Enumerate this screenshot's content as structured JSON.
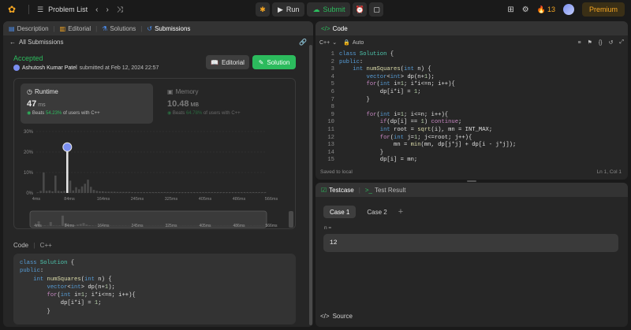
{
  "topbar": {
    "problem_list": "Problem List",
    "run": "Run",
    "submit": "Submit",
    "streak": "13",
    "premium": "Premium"
  },
  "left_tabs": [
    {
      "label": "Description",
      "icon": "description-icon"
    },
    {
      "label": "Editorial",
      "icon": "editorial-icon"
    },
    {
      "label": "Solutions",
      "icon": "solutions-icon"
    },
    {
      "label": "Submissions",
      "icon": "submissions-icon"
    }
  ],
  "submission": {
    "back_label": "All Submissions",
    "status": "Accepted",
    "author": "Ashutosh Kumar Patel",
    "submitted_text": "submitted at Feb 12, 2024 22:57",
    "editorial_btn": "Editorial",
    "solution_btn": "Solution"
  },
  "runtime": {
    "title": "Runtime",
    "value": "47",
    "unit": "ms",
    "beats_prefix": "Beats",
    "beats_pct": "54.23%",
    "beats_suffix": "of users with C++"
  },
  "memory": {
    "title": "Memory",
    "value": "10.48",
    "unit": "MB",
    "beats_prefix": "Beats",
    "beats_pct": "64.78%",
    "beats_suffix": "of users with C++"
  },
  "chart_data": {
    "type": "bar",
    "title": "",
    "xlabel": "",
    "ylabel": "",
    "y_ticks": [
      "30%",
      "20%",
      "10%",
      "0%"
    ],
    "ylim": [
      0,
      30
    ],
    "x_ticks": [
      "4ms",
      "84ms",
      "164ms",
      "245ms",
      "325ms",
      "405ms",
      "486ms",
      "566ms"
    ],
    "range_ticks": [
      "4ms",
      "84ms",
      "164ms",
      "245ms",
      "325ms",
      "405ms",
      "486ms",
      "566ms"
    ],
    "highlight_value_ms": 47,
    "values": [
      0.3,
      1.0,
      10.0,
      1.0,
      1.2,
      0.8,
      8.5,
      1.0,
      0.8,
      1.0,
      22.0,
      6.0,
      1.2,
      2.8,
      1.8,
      3.2,
      4.5,
      6.5,
      3.0,
      1.5,
      1.0,
      0.8,
      0.8,
      0.6,
      0.6,
      0.6,
      0.6,
      0.5,
      0.5,
      0.5,
      0.5,
      0.5,
      0.4,
      0.4,
      0.4,
      0.4,
      0.4,
      0.4,
      0.4,
      0.4,
      0.4,
      0.4,
      0.4,
      0.4,
      0.4,
      0.4,
      0.4,
      0.4,
      0.4,
      0.4,
      0.4,
      0.4,
      0.4,
      0.4,
      0.4,
      0.4,
      0.4,
      0.4,
      0.4,
      0.4,
      0.4,
      0.4,
      0.4,
      0.4,
      0.4,
      0.4,
      0.4,
      0.4,
      0.4,
      0.4,
      0.4,
      0.4,
      0.4,
      0.4,
      0.4,
      0.4,
      0.4,
      0.4
    ]
  },
  "code_section": {
    "label": "Code",
    "lang": "C++"
  },
  "left_code_lines": [
    "class Solution {",
    "public:",
    "    int numSquares(int n) {",
    "        vector<int> dp(n+1);",
    "        for(int i=1; i*i<=n; i++){",
    "            dp[i*i] = 1;",
    "        }"
  ],
  "code_panel": {
    "title": "Code",
    "lang": "C++",
    "mode": "Auto",
    "saved": "Saved to local",
    "position": "Ln 1, Col 1"
  },
  "editor_lines": [
    "class Solution {",
    "public:",
    "    int numSquares(int n) {",
    "        vector<int> dp(n+1);",
    "        for(int i=1; i*i<=n; i++){",
    "            dp[i*i] = 1;",
    "        }",
    "",
    "        for(int i=1; i<=n; i++){",
    "            if(dp[i] == 1) continue;",
    "            int root = sqrt(i), mn = INT_MAX;",
    "            for(int j=1; j<=root; j++){",
    "                mn = min(mn, dp[j*j] + dp[i - j*j]);",
    "            }",
    "            dp[i] = mn;"
  ],
  "testcase": {
    "tab_testcase": "Testcase",
    "tab_result": "Test Result",
    "cases": [
      "Case 1",
      "Case 2"
    ],
    "param_label": "n =",
    "param_value": "12",
    "source": "Source"
  }
}
